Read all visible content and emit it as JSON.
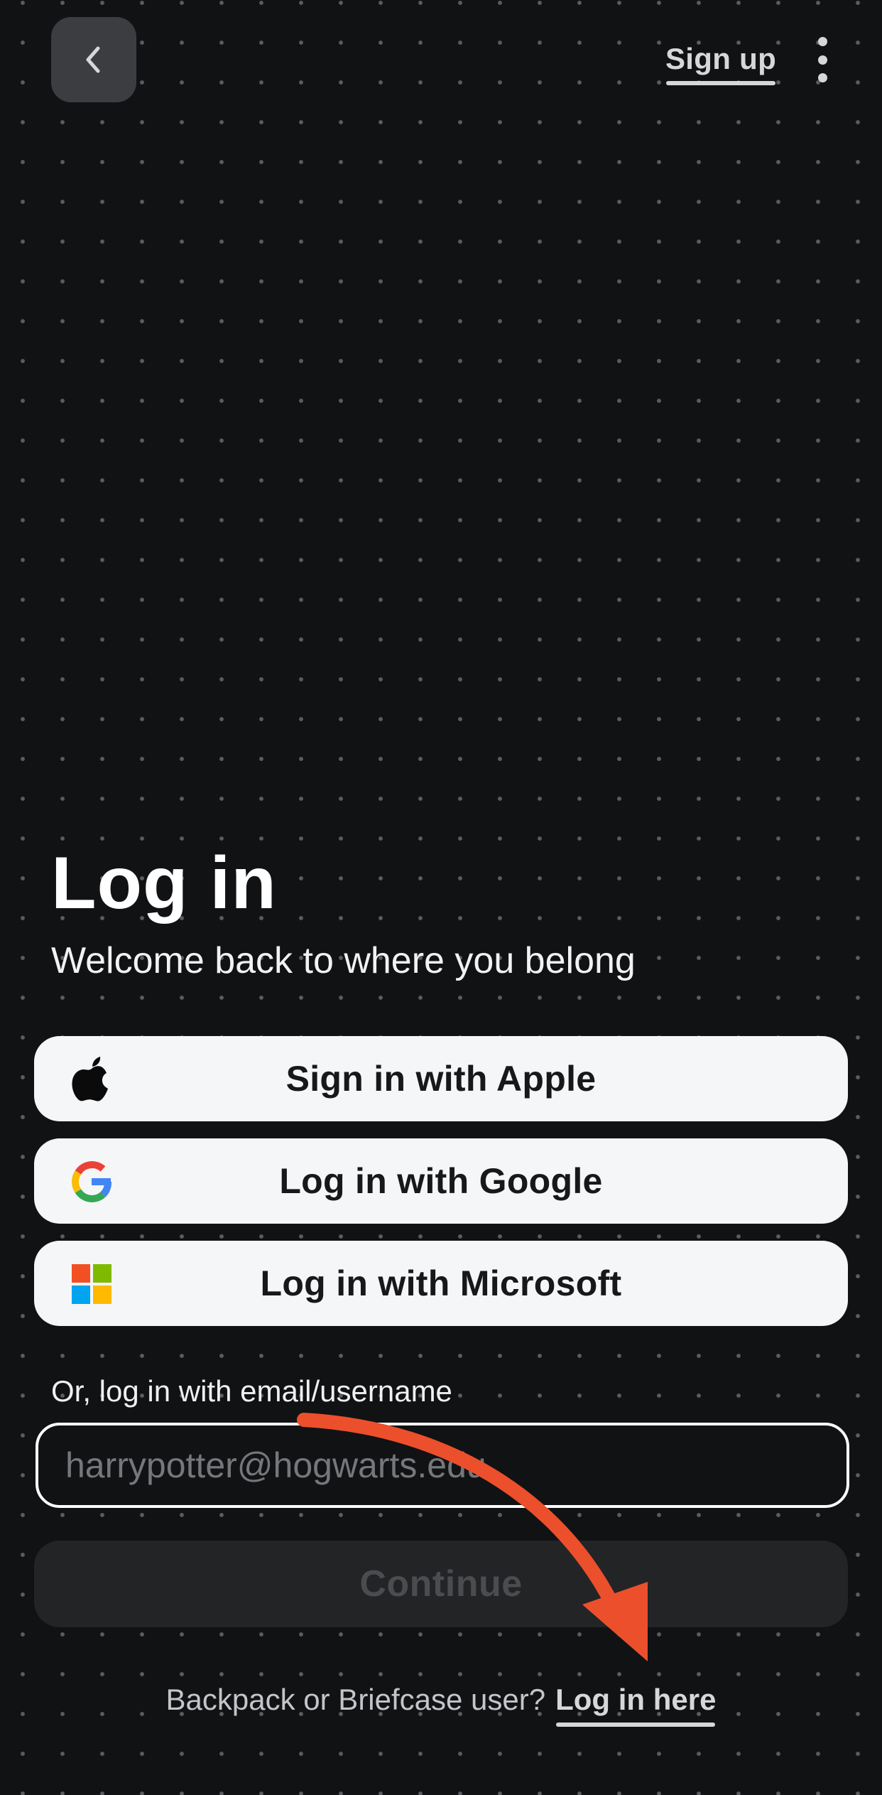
{
  "header": {
    "signup_label": "Sign up"
  },
  "main": {
    "title": "Log in",
    "subtitle": "Welcome back to where you belong"
  },
  "sso": {
    "apple_label": "Sign in with Apple",
    "google_label": "Log in with Google",
    "microsoft_label": "Log in with Microsoft"
  },
  "email": {
    "label": "Or, log in with email/username",
    "placeholder": "harrypotter@hogwarts.edu",
    "value": ""
  },
  "continue_label": "Continue",
  "footer": {
    "prompt": "Backpack or Briefcase user?",
    "link_label": "Log in here"
  },
  "colors": {
    "background": "#111214",
    "annotation_arrow": "#ec4f2c",
    "button_light": "#f5f6f8",
    "button_disabled": "#222426"
  },
  "icons": [
    "back-chevron-icon",
    "more-vertical-icon",
    "apple-icon",
    "google-icon",
    "microsoft-icon",
    "annotation-arrow"
  ]
}
